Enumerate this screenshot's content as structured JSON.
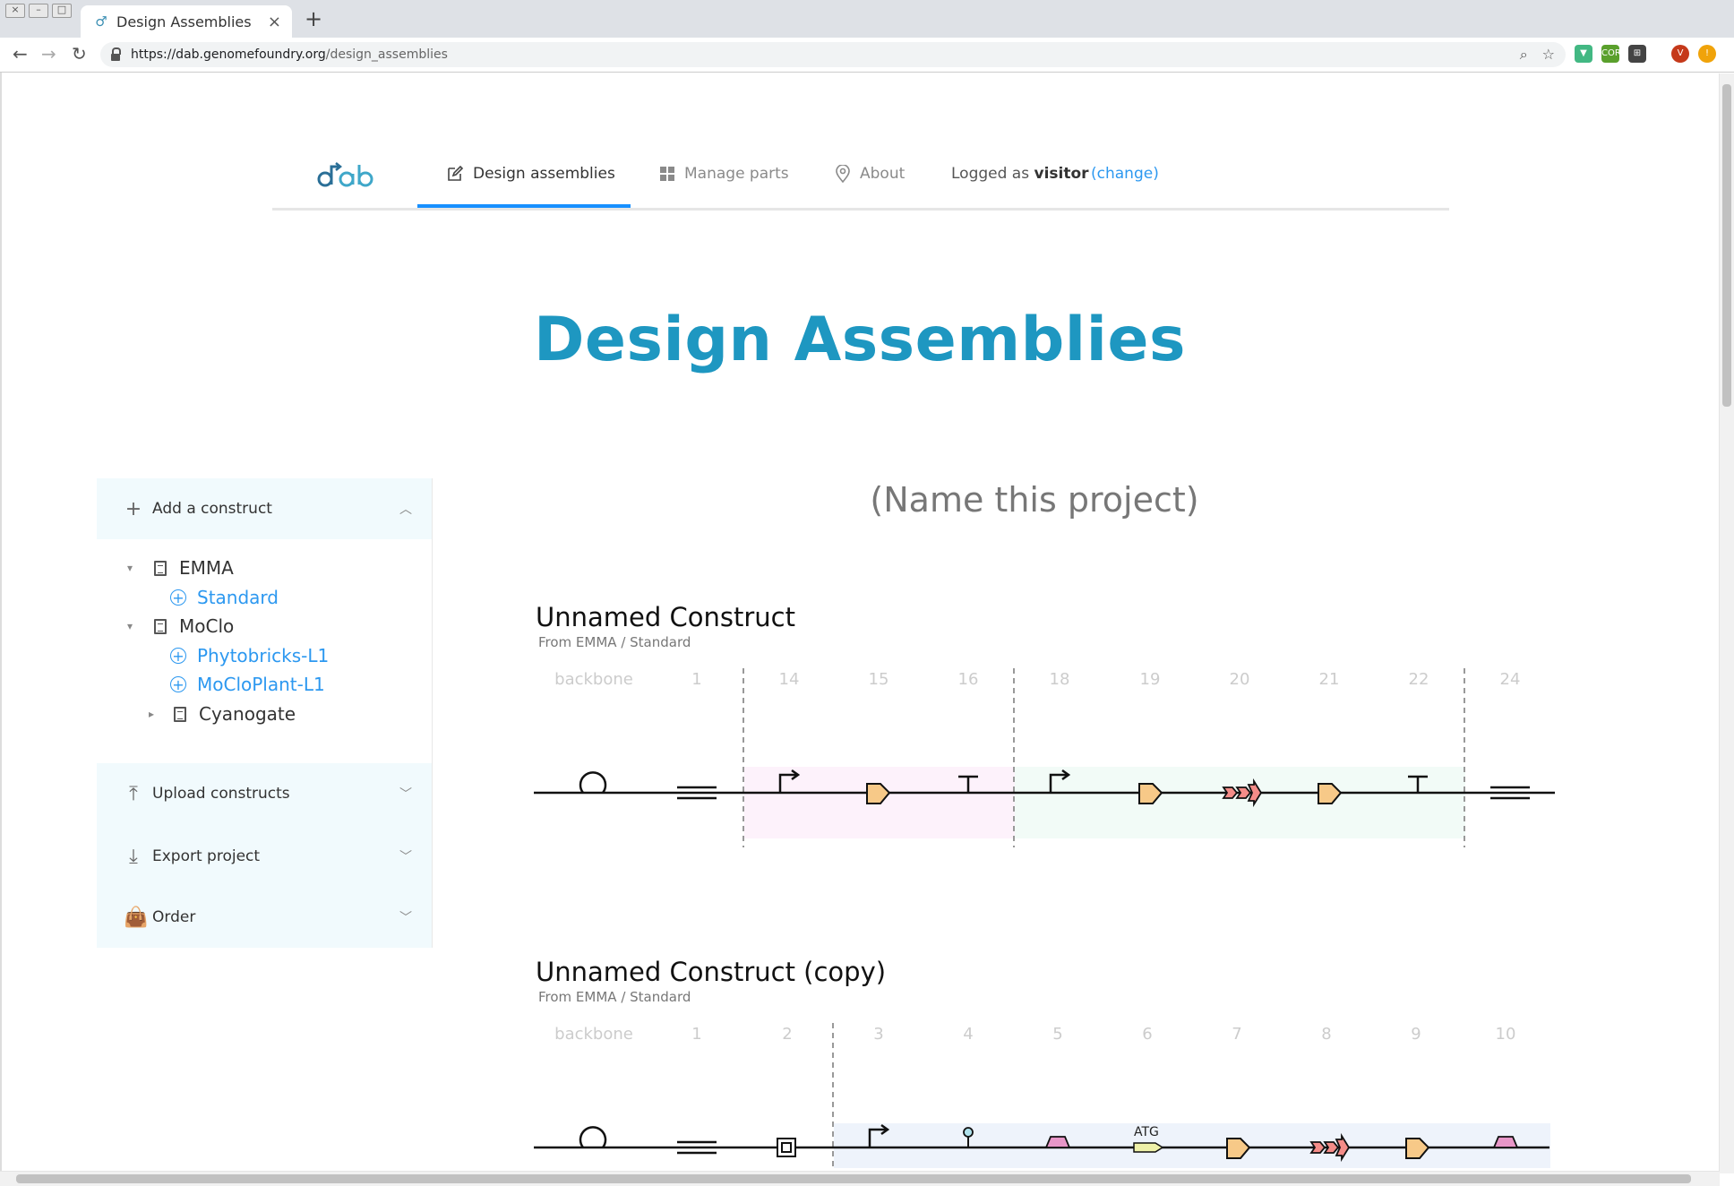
{
  "browser": {
    "tab_title": "Design Assemblies",
    "url_host": "https://dab.genomefoundry.org",
    "url_path": "/design_assemblies",
    "profile_initial": "V"
  },
  "nav": {
    "logo_text": "dab",
    "items": [
      {
        "label": "Design assemblies",
        "icon": "edit-icon"
      },
      {
        "label": "Manage parts",
        "icon": "grid-icon"
      },
      {
        "label": "About",
        "icon": "location-pin-icon"
      }
    ],
    "logged_prefix": "Logged as",
    "username": "visitor",
    "change_label": "(change)"
  },
  "page_title": "Design Assemblies",
  "sidebar": {
    "add_construct": "Add a construct",
    "tree": [
      {
        "label": "EMMA",
        "expanded": true,
        "children": [
          "Standard"
        ]
      },
      {
        "label": "MoClo",
        "expanded": true,
        "children": [
          "Phytobricks-L1",
          "MoCloPlant-L1"
        ]
      },
      {
        "label": "Cyanogate",
        "expanded": false
      }
    ],
    "upload": "Upload constructs",
    "export": "Export project",
    "order": "Order"
  },
  "project_name": "(Name this project)",
  "constructs": [
    {
      "title": "Unnamed Construct",
      "subtitle": "From EMMA / Standard",
      "slots": [
        "backbone",
        "1",
        "14",
        "15",
        "16",
        "18",
        "19",
        "20",
        "21",
        "22",
        "24"
      ],
      "parts": [
        "origin",
        "dual-line",
        "promoter",
        "cds",
        "terminator",
        "promoter",
        "cds",
        "multi-cds",
        "cds",
        "terminator",
        "dual-line"
      ],
      "highlight_colors": [
        "#fdf2fb",
        "#f2fbf7"
      ]
    },
    {
      "title": "Unnamed Construct (copy)",
      "subtitle": "From EMMA / Standard",
      "slots": [
        "backbone",
        "1",
        "2",
        "3",
        "4",
        "5",
        "6",
        "7",
        "8",
        "9",
        "10"
      ],
      "parts": [
        "origin",
        "dual-line",
        "insulator",
        "promoter",
        "operator",
        "rbs",
        "start-codon",
        "cds",
        "multi-cds",
        "cds",
        "rbs"
      ],
      "atg_label": "ATG",
      "highlight_colors": [
        "#eef3fb"
      ]
    }
  ],
  "colors": {
    "accent": "#1e97c1",
    "link": "#2c98f0",
    "cds": "#f7c988",
    "multi_cds": "#f48c88",
    "rbs": "#e896c8",
    "atg": "#eef0a8"
  }
}
